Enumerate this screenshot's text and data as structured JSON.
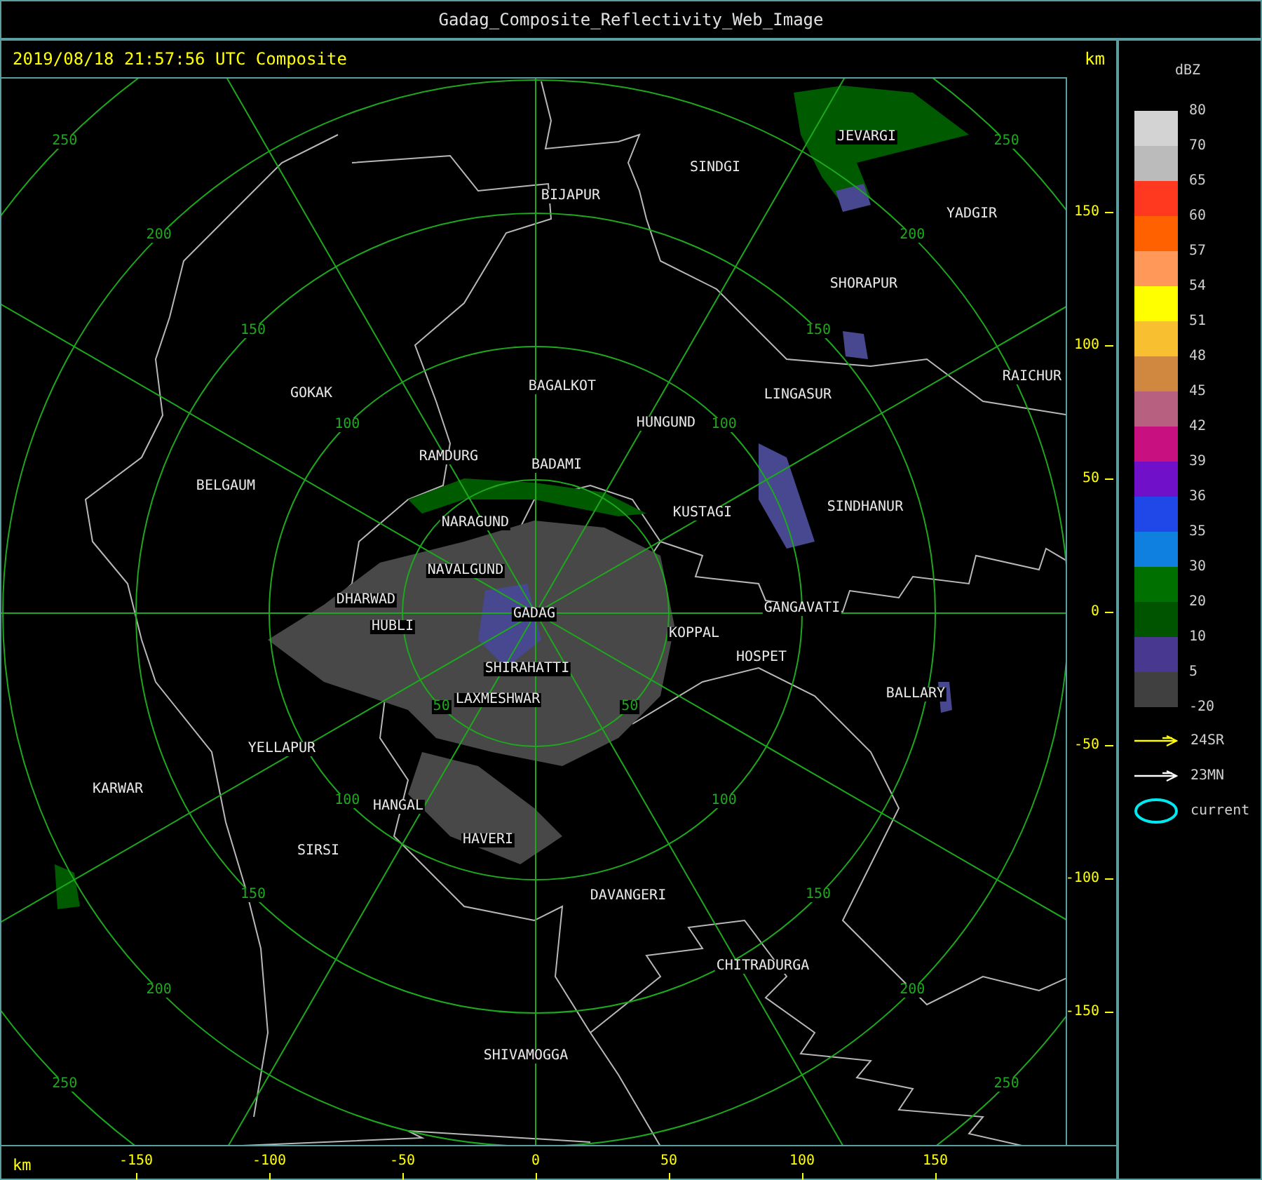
{
  "window": {
    "title": "Gadag_Composite_Reflectivity_Web_Image"
  },
  "header": {
    "timestamp": "2019/08/18 21:57:56 UTC Composite",
    "unit": "km"
  },
  "map": {
    "cities": [
      "JEVARGI",
      "SINDGI",
      "BIJAPUR",
      "YADGIR",
      "SHORAPUR",
      "RAICHUR",
      "GOKAK",
      "BAGALKOT",
      "LINGASUR",
      "HUNGUND",
      "RAMDURG",
      "BADAMI",
      "BELGAUM",
      "SINDHANUR",
      "KUSTAGI",
      "NARAGUND",
      "NAVALGUND",
      "DHARWAD",
      "GADAG",
      "GANGAVATI",
      "HUBLI",
      "KOPPAL",
      "SHIRAHATTI",
      "HOSPET",
      "BALLARY",
      "LAXMESHWAR",
      "YELLAPUR",
      "KARWAR",
      "HANGAL",
      "SIRSI",
      "HAVERI",
      "DAVANGERI",
      "CHITRADURGA",
      "SHIVAMOGGA"
    ],
    "ring_labels": [
      "250",
      "200",
      "150",
      "100",
      "250",
      "200",
      "150",
      "100",
      "250",
      "200",
      "150",
      "100",
      "50",
      "250",
      "200",
      "150",
      "100",
      "50"
    ]
  },
  "y_axis": {
    "ticks": [
      "150",
      "100",
      "50",
      "0",
      "-50",
      "-100",
      "-150"
    ]
  },
  "x_axis": {
    "unit": "km",
    "ticks": [
      "-150",
      "-100",
      "-50",
      "0",
      "50",
      "100",
      "150"
    ]
  },
  "legend": {
    "title": "dBZ",
    "labels": [
      "80",
      "70",
      "65",
      "60",
      "57",
      "54",
      "51",
      "48",
      "45",
      "42",
      "39",
      "36",
      "35",
      "30",
      "20",
      "10",
      "5",
      "-20"
    ],
    "segments": [
      {
        "color": "#d3d3d3"
      },
      {
        "color": "#bbbbbb"
      },
      {
        "color": "#ff3820"
      },
      {
        "color": "#ff6000"
      },
      {
        "color": "#ff9858"
      },
      {
        "color": "#ffff00"
      },
      {
        "color": "#f8c030"
      },
      {
        "color": "#d08840"
      },
      {
        "color": "#b86080"
      },
      {
        "color": "#c81080"
      },
      {
        "color": "#7010c8"
      },
      {
        "color": "#2048e8"
      },
      {
        "color": "#1080e0"
      },
      {
        "color": "#007000"
      },
      {
        "color": "#005400"
      },
      {
        "color": "#483890"
      },
      {
        "color": "#404040"
      }
    ],
    "markers": [
      {
        "kind": "arrow",
        "color": "#ffff00",
        "label": "24SR"
      },
      {
        "kind": "arrow",
        "color": "#ffffff",
        "label": "23MN"
      },
      {
        "kind": "ellipse",
        "color": "#00e8f0",
        "label": "current"
      }
    ]
  }
}
